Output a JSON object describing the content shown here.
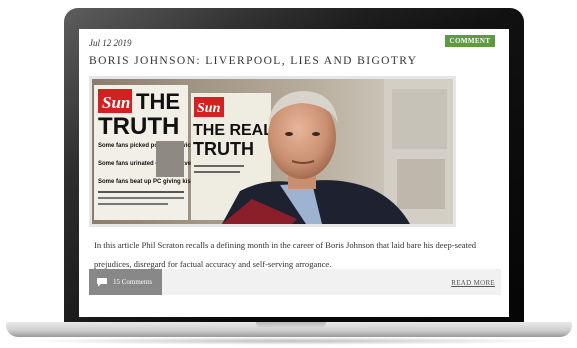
{
  "post": {
    "date": "Jul 12 2019",
    "category": "COMMENT",
    "title": "BORIS JOHNSON: LIVERPOOL, LIES AND BIGOTRY",
    "excerpt": "In this article Phil Scraton recalls a defining month in the career of Boris Johnson that laid bare his deep-seated prejudices, disregard for factual accuracy and self-serving arrogance.",
    "comments_label": "15 Comments",
    "read_more_label": "READ MORE"
  },
  "image": {
    "paper1_masthead": "Sun",
    "paper1_headline_line1": "THE",
    "paper1_headline_line2": "TRUTH",
    "paper1_bullets": [
      "Some fans picked pockets of victims",
      "Some fans urinated on the brave cops",
      "Some fans beat up PC giving kiss of life"
    ],
    "paper2_masthead": "Sun",
    "paper2_headline_line1": "THE REAL",
    "paper2_headline_line2": "TRUTH"
  },
  "colors": {
    "badge": "#5e9b3e",
    "comments_button": "#888888",
    "masthead_red": "#d42020"
  }
}
